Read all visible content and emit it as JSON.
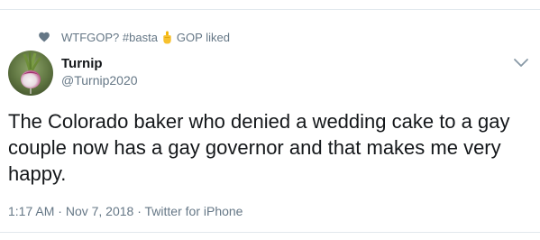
{
  "social_context": {
    "prefix": "WTFGOP? #basta",
    "emoji": "middle-finger-emoji",
    "suffix": "GOP liked"
  },
  "author": {
    "display_name": "Turnip",
    "handle": "@Turnip2020"
  },
  "tweet": {
    "text": "The Colorado baker who denied a wedding cake to a gay couple now has a gay governor and that makes me very happy."
  },
  "meta": {
    "time": "1:17 AM",
    "date": "Nov 7, 2018",
    "source": "Twitter for iPhone",
    "separator": "·"
  },
  "colors": {
    "text": "#14171a",
    "secondary": "#657786",
    "divider": "#e1e8ed"
  }
}
